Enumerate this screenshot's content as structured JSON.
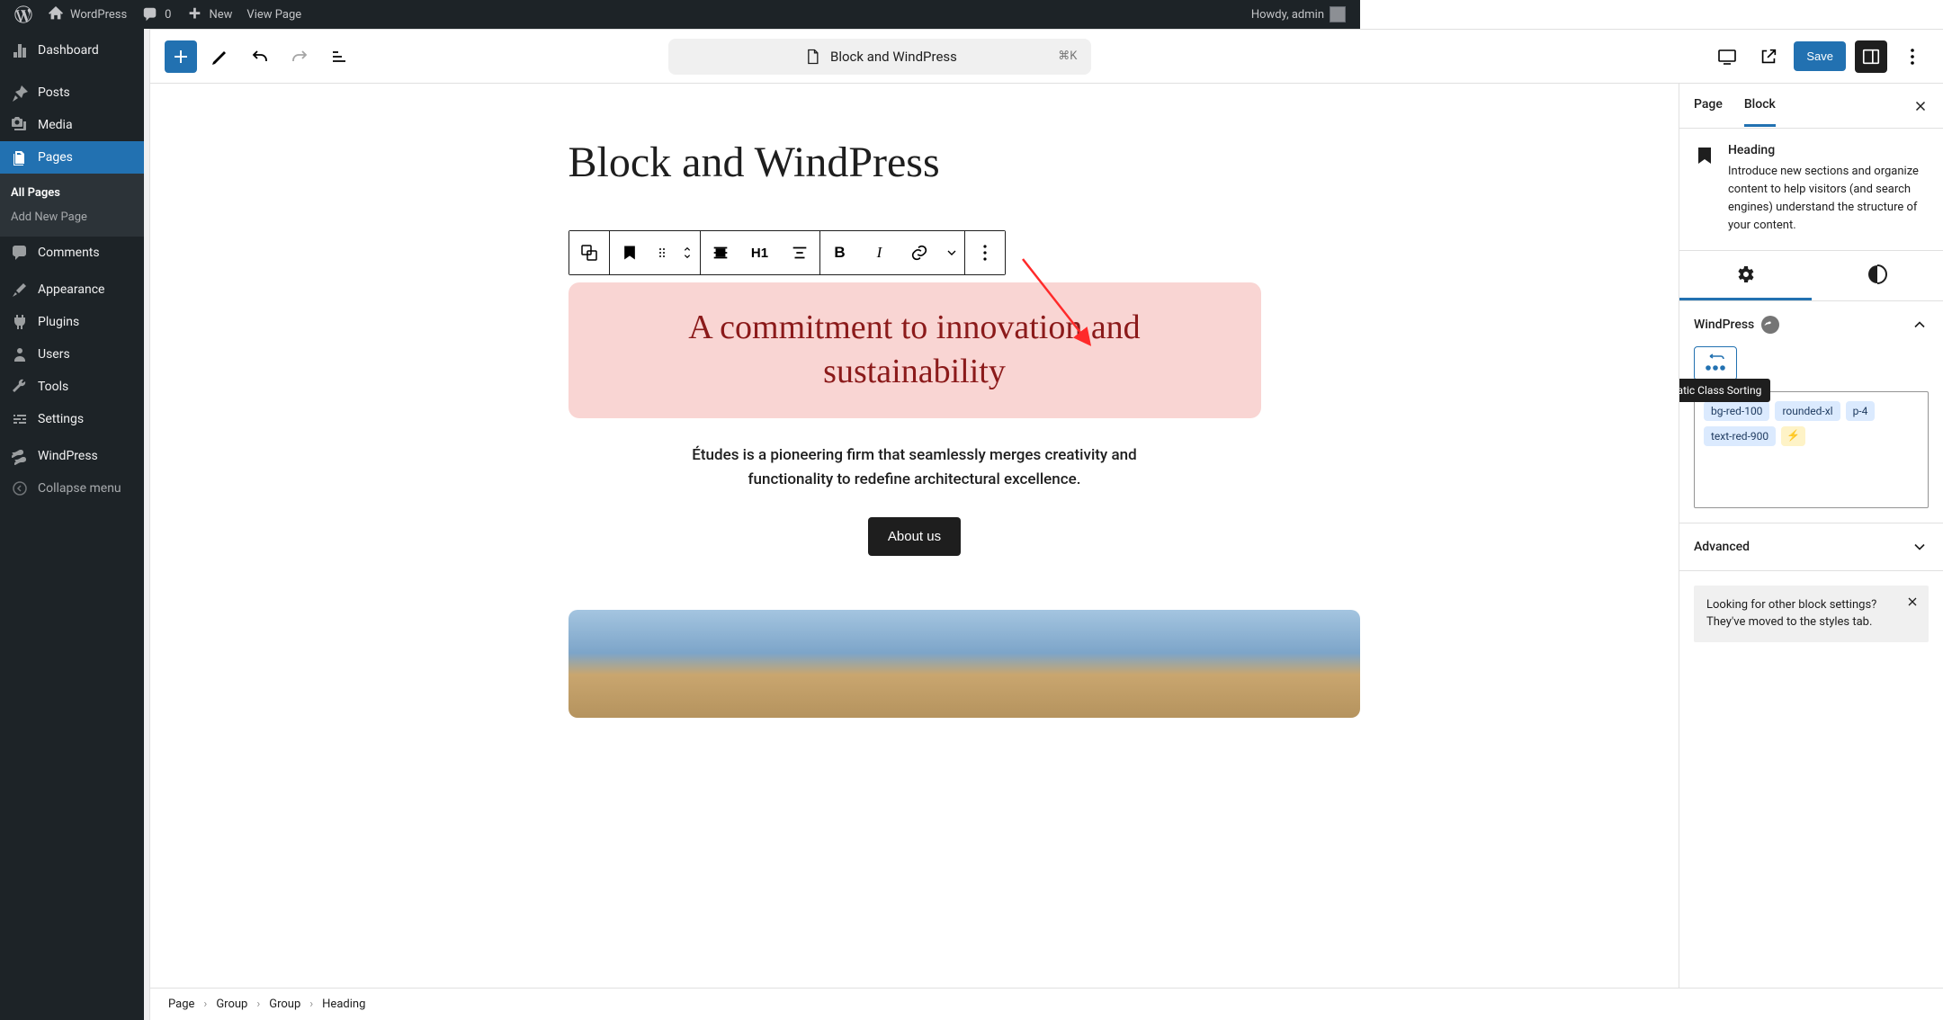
{
  "adminbar": {
    "site": "WordPress",
    "comments": "0",
    "new": "New",
    "viewpage": "View Page",
    "howdy": "Howdy, admin"
  },
  "sidebar": {
    "items": [
      {
        "label": "Dashboard"
      },
      {
        "label": "Posts"
      },
      {
        "label": "Media"
      },
      {
        "label": "Pages"
      },
      {
        "label": "Comments"
      },
      {
        "label": "Appearance"
      },
      {
        "label": "Plugins"
      },
      {
        "label": "Users"
      },
      {
        "label": "Tools"
      },
      {
        "label": "Settings"
      },
      {
        "label": "WindPress"
      },
      {
        "label": "Collapse menu"
      }
    ],
    "sub": {
      "all": "All Pages",
      "add": "Add New Page"
    }
  },
  "editor": {
    "docTitle": "Block and WindPress",
    "shortcut": "⌘K",
    "save": "Save",
    "pageTitle": "Block and WindPress",
    "heading": "A commitment to innovation and sustainability",
    "subtext": "Études is a pioneering firm that seamlessly merges creativity and functionality to redefine architectural excellence.",
    "aboutBtn": "About us",
    "h1Label": "H1",
    "breadcrumb": [
      "Page",
      "Group",
      "Group",
      "Heading"
    ]
  },
  "inspector": {
    "tabs": {
      "page": "Page",
      "block": "Block"
    },
    "block": {
      "name": "Heading",
      "desc": "Introduce new sections and organize content to help visitors (and search engines) understand the structure of your content."
    },
    "windpress": {
      "label": "WindPress",
      "tooltip": "Automatic Class Sorting",
      "classes": [
        "bg-red-100",
        "rounded-xl",
        "p-4",
        "text-red-900"
      ]
    },
    "advanced": "Advanced",
    "tip": "Looking for other block settings? They've moved to the styles tab."
  },
  "colors": {
    "wpBlue": "#2271b1",
    "highlightBg": "#f9d5d3",
    "highlightText": "#8b1a1a"
  }
}
